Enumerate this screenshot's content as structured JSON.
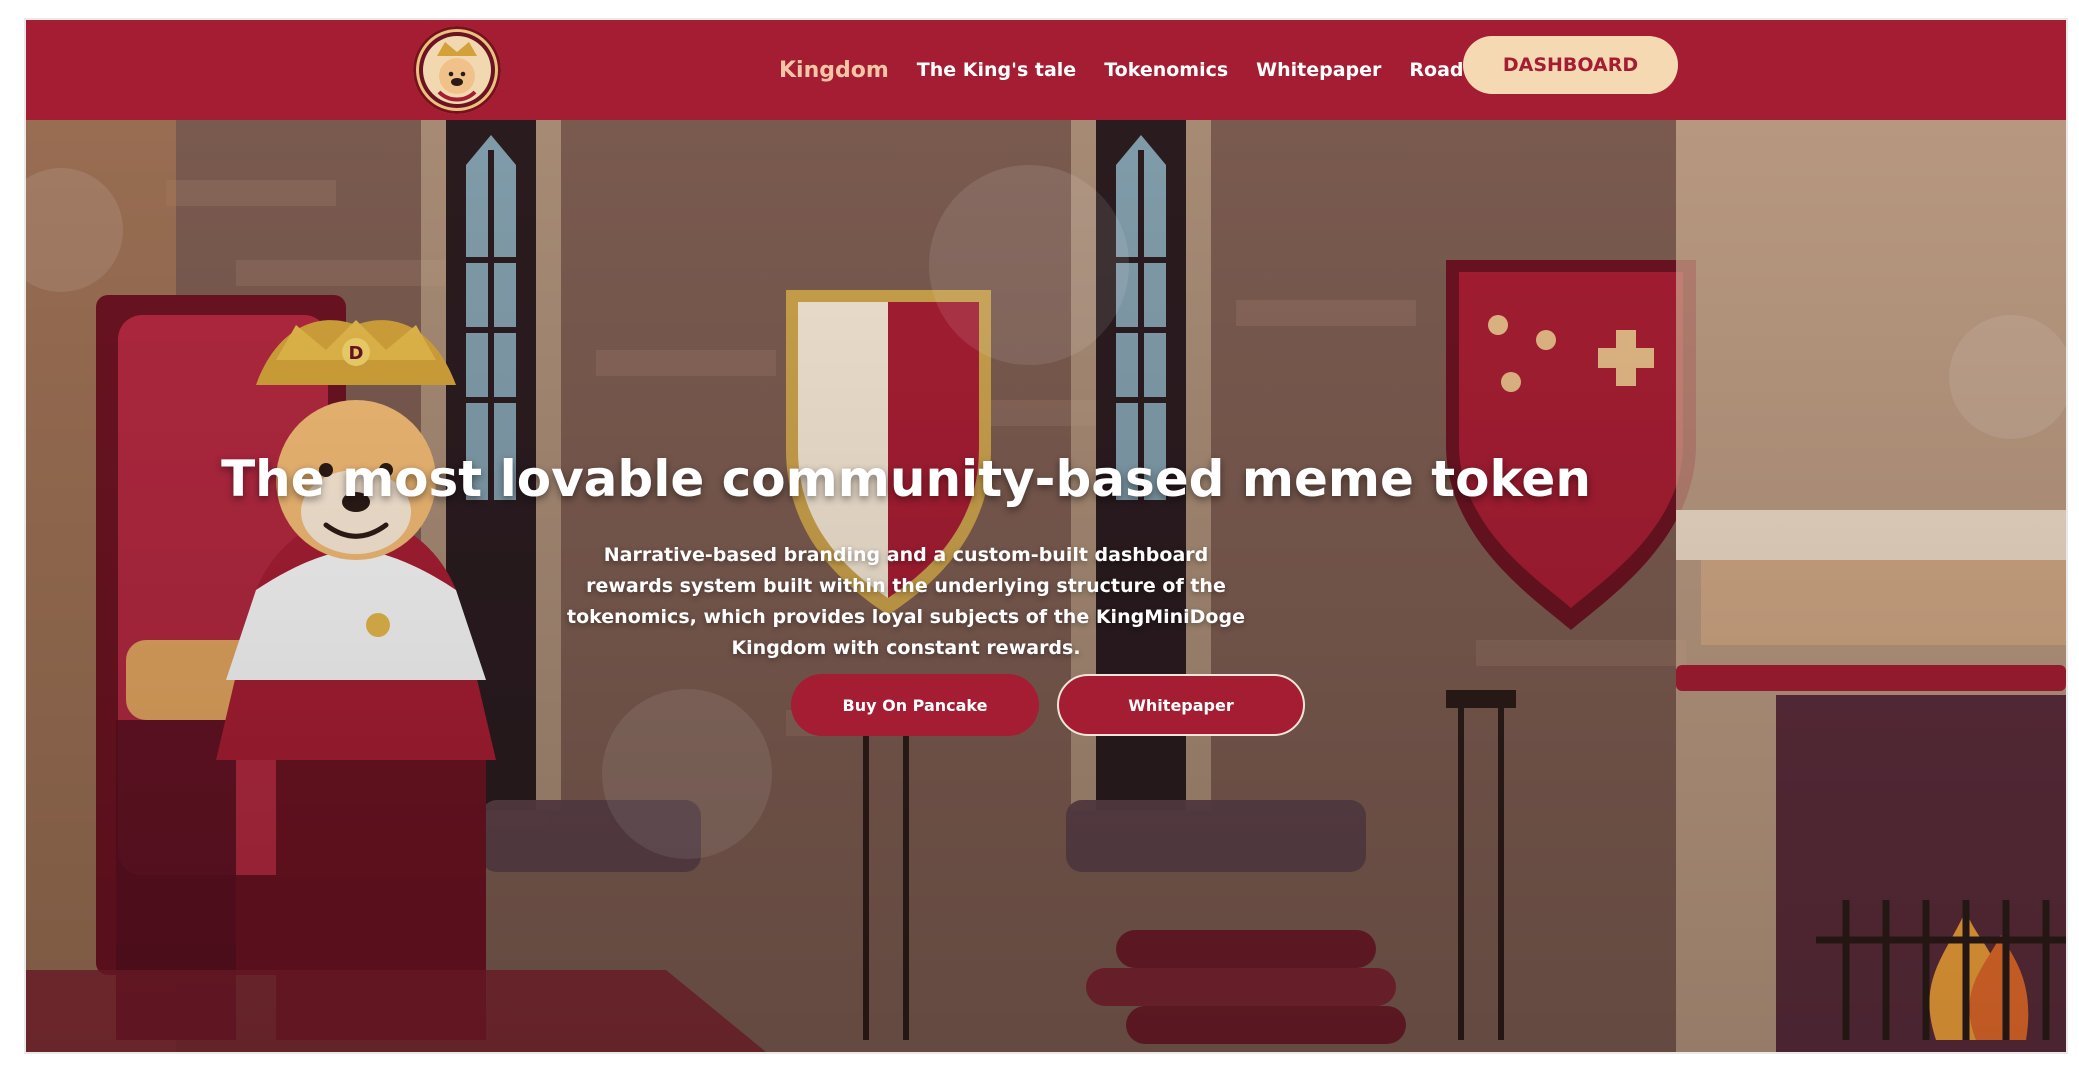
{
  "nav": {
    "logo_icon": "kingminidoge-logo",
    "items": [
      {
        "label": "Kingdom",
        "active": true
      },
      {
        "label": "The King's tale"
      },
      {
        "label": "Tokenomics"
      },
      {
        "label": "Whitepaper"
      },
      {
        "label": "Roadmap"
      }
    ],
    "dashboard_label": "DASHBOARD"
  },
  "hero": {
    "title": "The most lovable community-based meme token",
    "subtitle": "Narrative-based branding and a custom-built dashboard rewards system built within the underlying structure of the tokenomics, which provides loyal subjects of the KingMiniDoge Kingdom with constant rewards.",
    "buttons": [
      {
        "label": "Buy On Pancake"
      },
      {
        "label": "Whitepaper"
      }
    ]
  },
  "colors": {
    "primary_red": "#a41d32",
    "nav_active": "#f4c6a6",
    "dashboard_bg": "#f5d9b2",
    "wall": "#7a5a4f"
  }
}
